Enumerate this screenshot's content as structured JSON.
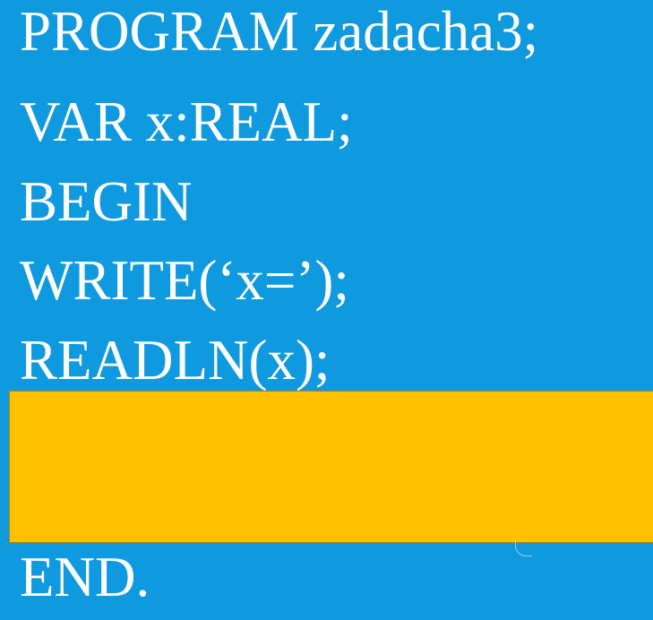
{
  "code": {
    "lines": [
      "PROGRAM  zadacha3;",
      "VAR x:REAL;",
      "BEGIN",
      "WRITE(‘x=’);",
      "READLN(x);"
    ],
    "end_line": "END."
  },
  "colors": {
    "background": "#0f9ae0",
    "text": "#ffffff",
    "highlight_box": "#ffc000"
  }
}
